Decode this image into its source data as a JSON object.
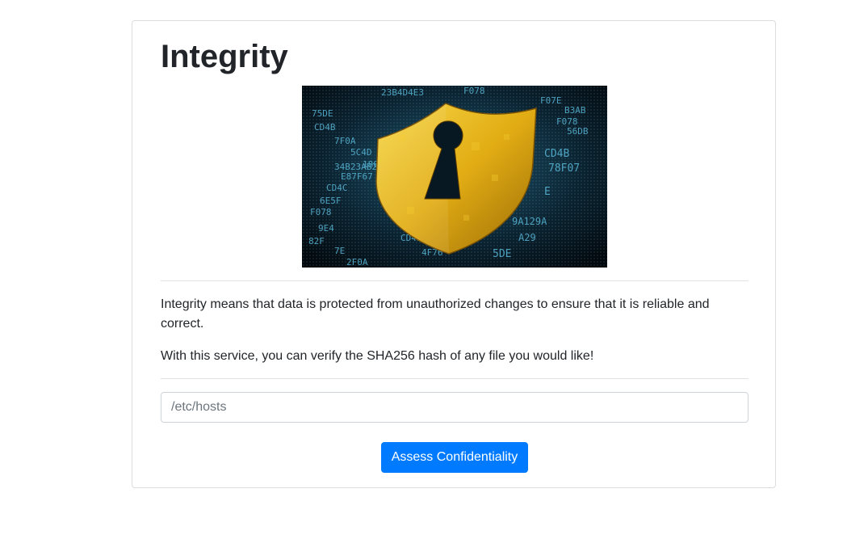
{
  "page": {
    "title": "Integrity",
    "description_1": "Integrity means that data is protected from unauthorized changes to ensure that it is reliable and correct.",
    "description_2": "With this service, you can verify the SHA256 hash of any file you would like!"
  },
  "hero_image": {
    "icon": "shield-keyhole-icon",
    "background_color": "#061018",
    "code_color": "#59b8d8",
    "shield_color": "#e8b81a"
  },
  "form": {
    "path_placeholder": "/etc/hosts",
    "path_value": "",
    "submit_label": "Assess Confidentiality",
    "accent_color": "#007bff"
  }
}
